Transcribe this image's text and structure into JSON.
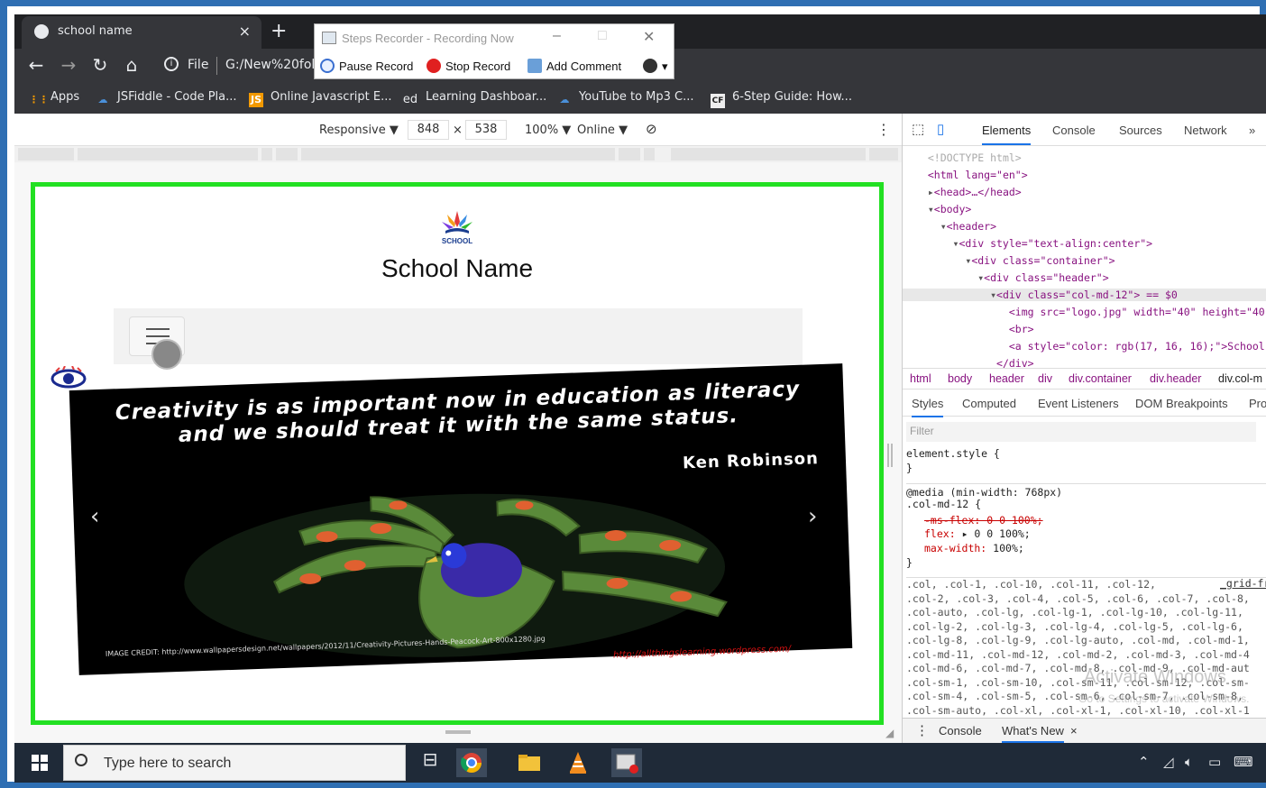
{
  "browser": {
    "tab_title": "school name",
    "tab_close": "×",
    "new_tab": "+",
    "url_file_label": "File",
    "url_text": "G:/New%20fol",
    "bookmarks": [
      {
        "label": "Apps",
        "icon": "apps-grid-icon"
      },
      {
        "label": "JSFiddle - Code Pla...",
        "icon": "jsfiddle-icon"
      },
      {
        "label": "Online Javascript E...",
        "icon": "js-icon",
        "badge": "JS"
      },
      {
        "label": "Learning Dashboar...",
        "icon": "ed-icon",
        "badge": "ed"
      },
      {
        "label": "YouTube to Mp3 C...",
        "icon": "youtube-mp3-icon"
      },
      {
        "label": "6-Step Guide: How...",
        "icon": "cf-icon",
        "badge": "CF"
      }
    ]
  },
  "steps_recorder": {
    "title": "Steps Recorder - Recording Now",
    "pause": "Pause Record",
    "stop": "Stop Record",
    "add_comment": "Add Comment"
  },
  "device_toolbar": {
    "mode": "Responsive ▼",
    "width": "848",
    "x": "×",
    "height": "538",
    "zoom": "100% ▼",
    "network": "Online ▼"
  },
  "page": {
    "school_name": "School Name",
    "logo_text": "SCHOOL",
    "slide": {
      "quote": "Creativity is as important now in education as literacy and we should treat it with the same status.",
      "author": "Ken Robinson",
      "credit": "IMAGE CREDIT: http://www.wallpapersdesign.net/wallpapers/2012/11/Creativity-Pictures-Hands-Peacock-Art-800x1280.jpg",
      "link": "http://allthingslearning.wordpress.com/"
    },
    "prev": "‹",
    "next": "›"
  },
  "devtools": {
    "tabs": [
      "Elements",
      "Console",
      "Sources",
      "Network",
      "»"
    ],
    "breadcrumbs": [
      "html",
      "body",
      "header",
      "div",
      "div.container",
      "div.header",
      "div.col-m"
    ],
    "style_tabs": [
      "Styles",
      "Computed",
      "Event Listeners",
      "DOM Breakpoints",
      "Pro"
    ],
    "filter_placeholder": "Filter",
    "element_style": "element.style {",
    "close_brace": "}",
    "media": "@media (min-width: 768px)",
    "rule_selector": ".col-md-12 {",
    "prop1": "-ms-flex: 0 0 100%;",
    "prop2_name": "flex:",
    "prop2_value": "▸ 0 0 100%;",
    "prop3_name": "max-width:",
    "prop3_value": " 100%;",
    "grid_link": "_grid-fr",
    "selectors": [
      ".col, .col-1, .col-10, .col-11, .col-12,",
      ".col-2, .col-3, .col-4, .col-5, .col-6, .col-7, .col-8,",
      ".col-auto, .col-lg, .col-lg-1, .col-lg-10, .col-lg-11,",
      ".col-lg-2, .col-lg-3, .col-lg-4, .col-lg-5, .col-lg-6,",
      ".col-lg-8, .col-lg-9, .col-lg-auto, .col-md, .col-md-1,",
      ".col-md-11, .col-md-12, .col-md-2, .col-md-3, .col-md-4",
      ".col-md-6, .col-md-7, .col-md-8, .col-md-9, .col-md-aut",
      ".col-sm-1, .col-sm-10, .col-sm-11, .col-sm-12, .col-sm-",
      ".col-sm-4, .col-sm-5, .col-sm-6, .col-sm-7, .col-sm-8,",
      ".col-sm-auto, .col-xl, .col-xl-1, .col-xl-10, .col-xl-1"
    ],
    "drawer_console": "Console",
    "drawer_whatsnew": "What's New",
    "drawer_close": "×"
  },
  "dom_lines": [
    {
      "indent": "  ",
      "html": "<!DOCTYPE html>"
    },
    {
      "indent": "  ",
      "html": "<html lang=\"en\">"
    },
    {
      "indent": "  ▸",
      "html": "<head>…</head>"
    },
    {
      "indent": "  ▾",
      "html": "<body>"
    },
    {
      "indent": "    ▾",
      "html": "<header>"
    },
    {
      "indent": "      ▾",
      "html": "<div style=\"text-align:center\">"
    },
    {
      "indent": "        ▾",
      "html": "<div class=\"container\">"
    },
    {
      "indent": "          ▾",
      "html": "<div class=\"header\">"
    },
    {
      "indent": "            ▾",
      "html": "<div class=\"col-md-12\"> == $0"
    },
    {
      "indent": "               ",
      "html": "<img src=\"logo.jpg\" width=\"40\" height=\"40"
    },
    {
      "indent": "               ",
      "html": "<br>"
    },
    {
      "indent": "               ",
      "html": "<a style=\"color: rgb(17, 16, 16);\">School"
    },
    {
      "indent": "             ",
      "html": "</div>"
    }
  ],
  "watermark": {
    "title": "Activate Windows",
    "subtitle": "Go to Settings to activate Windows."
  },
  "taskbar": {
    "search_placeholder": "Type here to search",
    "icons": [
      "task-view-icon",
      "chrome-icon",
      "file-explorer-icon",
      "vlc-icon",
      "steps-recorder-icon"
    ]
  },
  "colors": {
    "accent_green": "#22e022",
    "frame_blue": "#2f6fb3",
    "chrome_dark": "#35363a",
    "taskbar": "#1f2a38"
  }
}
